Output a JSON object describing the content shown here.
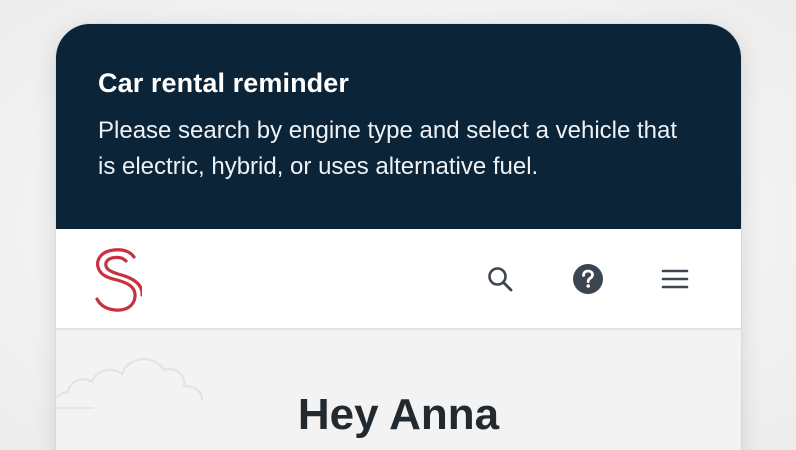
{
  "banner": {
    "title": "Car rental reminder",
    "message": "Please search by engine type and select a vehicle that is electric, hybrid, or uses alternative fuel."
  },
  "navbar": {
    "logo_icon": "s-logo-icon",
    "actions": [
      {
        "name": "search",
        "icon": "search-icon"
      },
      {
        "name": "help",
        "icon": "help-circle-icon"
      },
      {
        "name": "menu",
        "icon": "hamburger-menu-icon"
      }
    ]
  },
  "main": {
    "greeting": "Hey Anna"
  },
  "colors": {
    "banner_bg": "#0b2438",
    "brand_red": "#c8323e",
    "icon_dark": "#3c4650"
  }
}
